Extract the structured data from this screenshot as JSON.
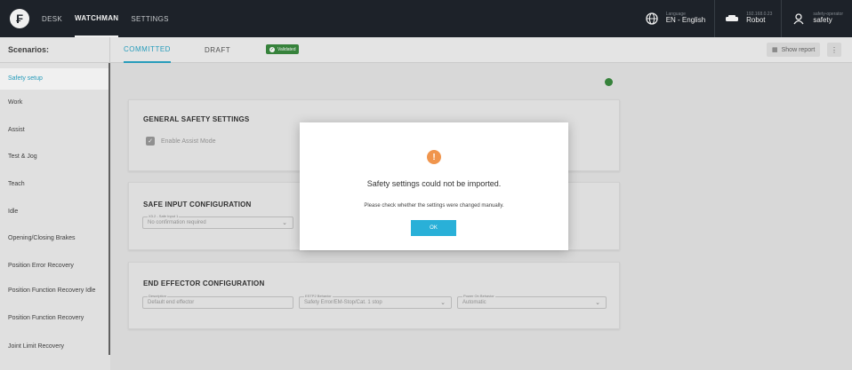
{
  "topbar": {
    "logo_icon": "franka-logo-icon",
    "nav": [
      {
        "label": "DESK"
      },
      {
        "label": "WATCHMAN"
      },
      {
        "label": "SETTINGS"
      }
    ],
    "language": {
      "small": "Language",
      "main": "EN - English"
    },
    "robot": {
      "small": "192.168.0.23",
      "main": "Robot"
    },
    "user": {
      "small": "safety-operator",
      "main": "safety"
    }
  },
  "subheader": {
    "scenarios_label": "Scenarios:",
    "tab_committed": "COMMITTED",
    "tab_draft": "DRAFT",
    "badge": "Validated",
    "show_report": "Show report",
    "more": "⋮"
  },
  "sidebar": {
    "items": [
      {
        "label": "Safety setup"
      },
      {
        "label": "Work"
      },
      {
        "label": "Assist"
      },
      {
        "label": "Test & Jog"
      },
      {
        "label": "Teach"
      },
      {
        "label": "Idle"
      },
      {
        "label": "Opening/Closing Brakes"
      },
      {
        "label": "Position Error Recovery"
      },
      {
        "label": "Position Function Recovery Idle"
      },
      {
        "label": "Position Function Recovery"
      },
      {
        "label": "Joint Limit Recovery"
      }
    ]
  },
  "general": {
    "title": "GENERAL SAFETY SETTINGS",
    "checkbox_label": "Enable Assist Mode"
  },
  "safe_input": {
    "title": "SAFE INPUT CONFIGURATION",
    "field_label": "X3.2 - Safe Input 1",
    "field_value": "No confirmation required"
  },
  "end_effector": {
    "title": "END EFFECTOR CONFIGURATION",
    "description_label": "Description",
    "description_value": "Default end effector",
    "estop_label": "ESTP2 Behavior",
    "estop_value": "Safety Error/EM-Stop/Cat. 1 stop",
    "power_label": "Power On Behavior",
    "power_value": "Automatic"
  },
  "modal": {
    "title": "Safety settings could not be imported.",
    "text": "Please check whether the settings were changed manually.",
    "ok": "OK"
  },
  "colors": {
    "accent": "#2aa6c7",
    "ok_button": "#29b0d8",
    "warning": "#f0954d",
    "validated": "#3a8b3f",
    "topbar": "#1f252c"
  }
}
